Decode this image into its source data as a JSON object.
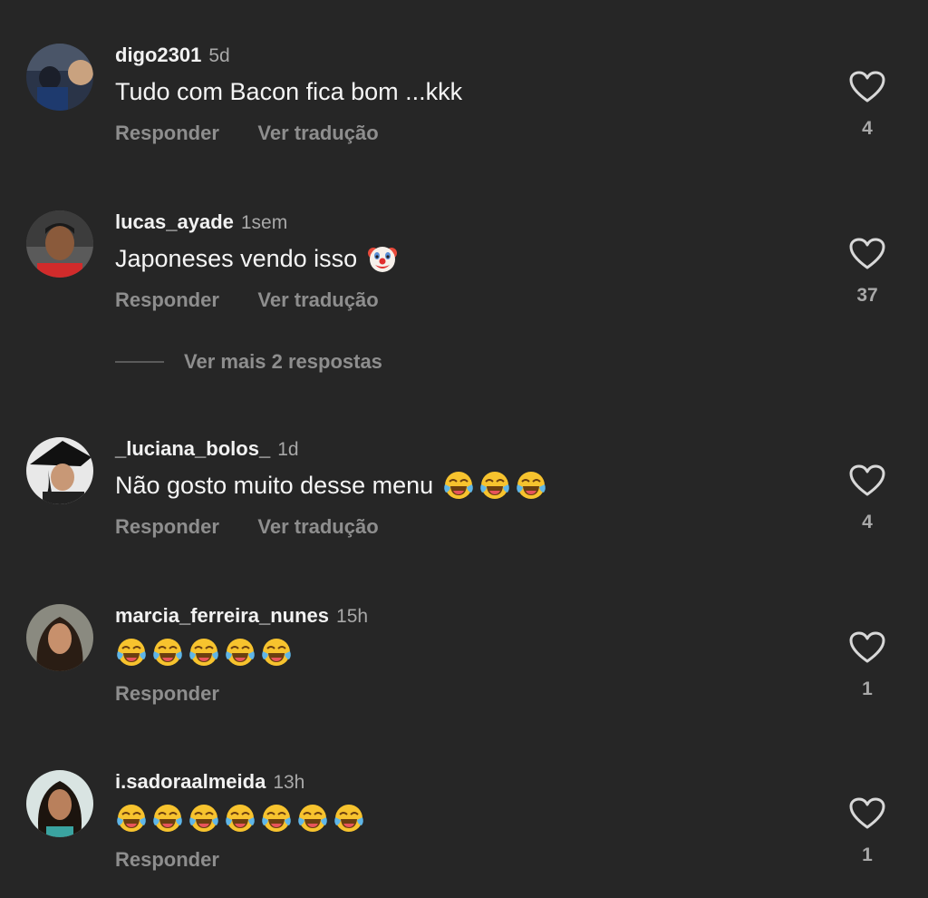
{
  "comments": [
    {
      "username": "digo2301",
      "time": "5d",
      "text": "Tudo com Bacon fica bom ...kkk",
      "emojis": [],
      "reply_label": "Responder",
      "translate_label": "Ver tradução",
      "likes": "4"
    },
    {
      "username": "lucas_ayade",
      "time": "1sem",
      "text": "Japoneses vendo isso",
      "emojis": [
        "clown-face"
      ],
      "reply_label": "Responder",
      "translate_label": "Ver tradução",
      "likes": "37",
      "more_replies": "Ver mais 2 respostas"
    },
    {
      "username": "_luciana_bolos_",
      "time": "1d",
      "text": "Não gosto muito desse menu",
      "emojis": [
        "face-with-tears-of-joy",
        "face-with-tears-of-joy",
        "face-with-tears-of-joy"
      ],
      "reply_label": "Responder",
      "translate_label": "Ver tradução",
      "likes": "4"
    },
    {
      "username": "marcia_ferreira_nunes",
      "time": "15h",
      "text": "",
      "emojis": [
        "face-with-tears-of-joy",
        "face-with-tears-of-joy",
        "face-with-tears-of-joy",
        "face-with-tears-of-joy",
        "face-with-tears-of-joy"
      ],
      "reply_label": "Responder",
      "likes": "1"
    },
    {
      "username": "i.sadoraalmeida",
      "time": "13h",
      "text": "",
      "emojis": [
        "face-with-tears-of-joy",
        "face-with-tears-of-joy",
        "face-with-tears-of-joy",
        "face-with-tears-of-joy",
        "face-with-tears-of-joy",
        "face-with-tears-of-joy",
        "face-with-tears-of-joy"
      ],
      "reply_label": "Responder",
      "likes": "1"
    }
  ],
  "icons": {
    "like": "heart-outline-icon"
  },
  "colors": {
    "background": "#262626",
    "primary_text": "#f5f5f5",
    "secondary_text": "#8e8e8e"
  }
}
